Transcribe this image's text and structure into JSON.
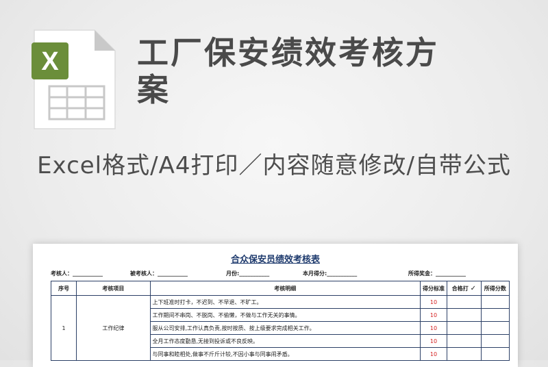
{
  "icon": {
    "name": "excel-file-icon",
    "letter": "X",
    "accent": "#6b8e3a"
  },
  "title": "工厂保安绩效考核方案",
  "subtitle": "Excel格式/A4打印／内容随意修改/自带公式",
  "sheet": {
    "title": "合众保安员绩效考核表",
    "meta": {
      "assessor": "考核人：___________",
      "assessee": "被考核人：___________",
      "month": "月份:___________",
      "score": "本月得分:___________",
      "bonus": "所得奖金：___________"
    },
    "headers": {
      "no": "序号",
      "item": "考核项目",
      "detail": "考核明细",
      "standard": "得分标准",
      "qualified": "合格打",
      "qualified_mark": "✓",
      "obtained": "所得分数"
    },
    "group": {
      "no": "1",
      "item": "工作纪律"
    },
    "rows": [
      {
        "detail": "上下班准时打卡，不迟到、不早退、不旷工。",
        "score": "10"
      },
      {
        "detail": "工作期间不串岗、不脱岗、不偷懒，不做与工作无关的事情。",
        "score": "10"
      },
      {
        "detail": "服从公司安排,工作认真负责,按时按质、按上级要求完成相关工作。",
        "score": "10"
      },
      {
        "detail": "全月工作态度勤恳,无接到投诉或不良反映。",
        "score": "10"
      },
      {
        "detail": "与同事和睦相处,做事不斤斤计较,不因小事与同事闹矛盾。",
        "score": "10"
      }
    ]
  }
}
